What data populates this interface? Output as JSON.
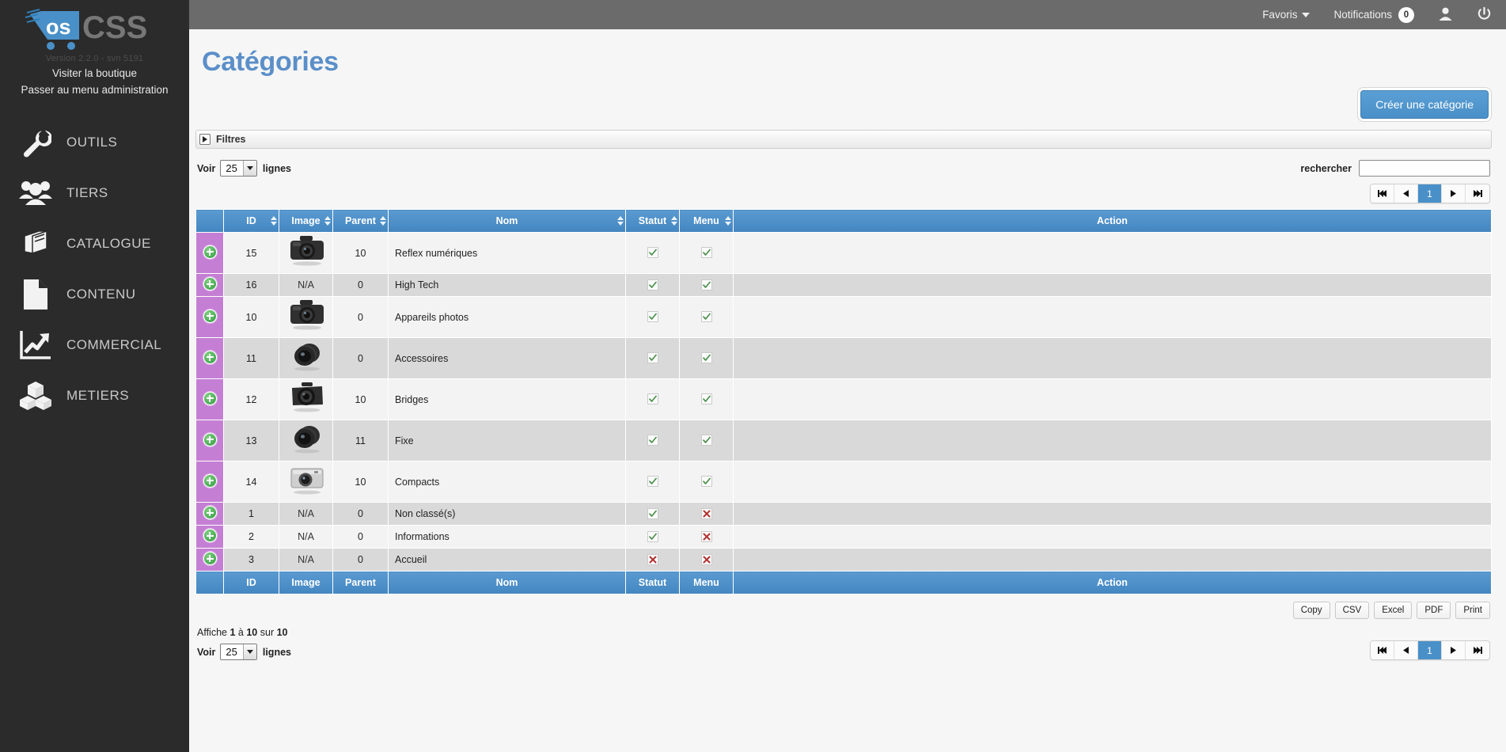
{
  "sidebar": {
    "logo_os": "os",
    "logo_css": "CSS",
    "version": "Version 2.2.0 - svn 5191",
    "links": [
      {
        "label": "Visiter la boutique"
      },
      {
        "label": "Passer au menu administration"
      }
    ],
    "menu": [
      {
        "label": "OUTILS",
        "icon": "wrench-icon"
      },
      {
        "label": "TIERS",
        "icon": "users-icon"
      },
      {
        "label": "CATALOGUE",
        "icon": "book-icon"
      },
      {
        "label": "CONTENU",
        "icon": "document-icon"
      },
      {
        "label": "COMMERCIAL",
        "icon": "chart-arrow-icon"
      },
      {
        "label": "METIERS",
        "icon": "cubes-icon"
      }
    ]
  },
  "topbar": {
    "favoris": "Favoris",
    "notifications": "Notifications",
    "notifications_count": "0",
    "user_icon": "user-icon",
    "power_icon": "power-icon"
  },
  "page": {
    "title": "Catégories",
    "create_button": "Créer une catégorie",
    "filters_label": "Filtres"
  },
  "controls": {
    "voir": "Voir",
    "length_value": "25",
    "lignes": "lignes",
    "search_label": "rechercher",
    "search_value": "",
    "search_placeholder": ""
  },
  "pagination": {
    "first": "first-page-icon",
    "prev": "previous-page-icon",
    "page": "1",
    "next": "next-page-icon",
    "last": "last-page-icon"
  },
  "table": {
    "columns": [
      {
        "key": "select",
        "label": "",
        "sortable": false
      },
      {
        "key": "id",
        "label": "ID",
        "sortable": true
      },
      {
        "key": "image",
        "label": "Image",
        "sortable": true
      },
      {
        "key": "parent",
        "label": "Parent",
        "sortable": true
      },
      {
        "key": "nom",
        "label": "Nom",
        "sortable": true
      },
      {
        "key": "statut",
        "label": "Statut",
        "sortable": true
      },
      {
        "key": "menu",
        "label": "Menu",
        "sortable": true
      },
      {
        "key": "action",
        "label": "Action",
        "sortable": false
      }
    ],
    "rows": [
      {
        "id": "15",
        "image": "dslr-camera-thumb",
        "parent": "10",
        "nom": "Reflex numériques",
        "statut": "check",
        "menu": "check",
        "action": "",
        "tall": true
      },
      {
        "id": "16",
        "image": "N/A",
        "parent": "0",
        "nom": "High Tech",
        "statut": "check",
        "menu": "check",
        "action": "",
        "tall": false
      },
      {
        "id": "10",
        "image": "dslr-camera-thumb",
        "parent": "0",
        "nom": "Appareils photos",
        "statut": "check",
        "menu": "check",
        "action": "",
        "tall": true
      },
      {
        "id": "11",
        "image": "lens-thumb",
        "parent": "0",
        "nom": "Accessoires",
        "statut": "check",
        "menu": "check",
        "action": "",
        "tall": true
      },
      {
        "id": "12",
        "image": "bridge-camera-thumb",
        "parent": "10",
        "nom": "Bridges",
        "statut": "check",
        "menu": "check",
        "action": "",
        "tall": true
      },
      {
        "id": "13",
        "image": "lens-thumb",
        "parent": "11",
        "nom": "Fixe",
        "statut": "check",
        "menu": "check",
        "action": "",
        "tall": true
      },
      {
        "id": "14",
        "image": "compact-camera-thumb",
        "parent": "10",
        "nom": "Compacts",
        "statut": "check",
        "menu": "check",
        "action": "",
        "tall": true
      },
      {
        "id": "1",
        "image": "N/A",
        "parent": "0",
        "nom": "Non classé(s)",
        "statut": "check",
        "menu": "cross",
        "action": "",
        "tall": false
      },
      {
        "id": "2",
        "image": "N/A",
        "parent": "0",
        "nom": "Informations",
        "statut": "check",
        "menu": "cross",
        "action": "",
        "tall": false
      },
      {
        "id": "3",
        "image": "N/A",
        "parent": "0",
        "nom": "Accueil",
        "statut": "cross",
        "menu": "cross",
        "action": "",
        "tall": false
      }
    ]
  },
  "export": {
    "buttons": [
      "Copy",
      "CSV",
      "Excel",
      "PDF",
      "Print"
    ]
  },
  "footer": {
    "info_prefix": "Affiche",
    "info_from": "1",
    "info_mid": "à",
    "info_to": "10",
    "info_of": "sur",
    "info_total": "10",
    "voir": "Voir",
    "length_value": "25",
    "lignes": "lignes"
  },
  "colors": {
    "accent_blue": "#4a90c8",
    "title_blue": "#5b8fc9",
    "select_purple": "#c47fd4",
    "sidebar_dark": "#2b2b2b",
    "topbar_gray": "#6b6b6b",
    "check_green": "#4a8f4a",
    "cross_red": "#b03030"
  }
}
